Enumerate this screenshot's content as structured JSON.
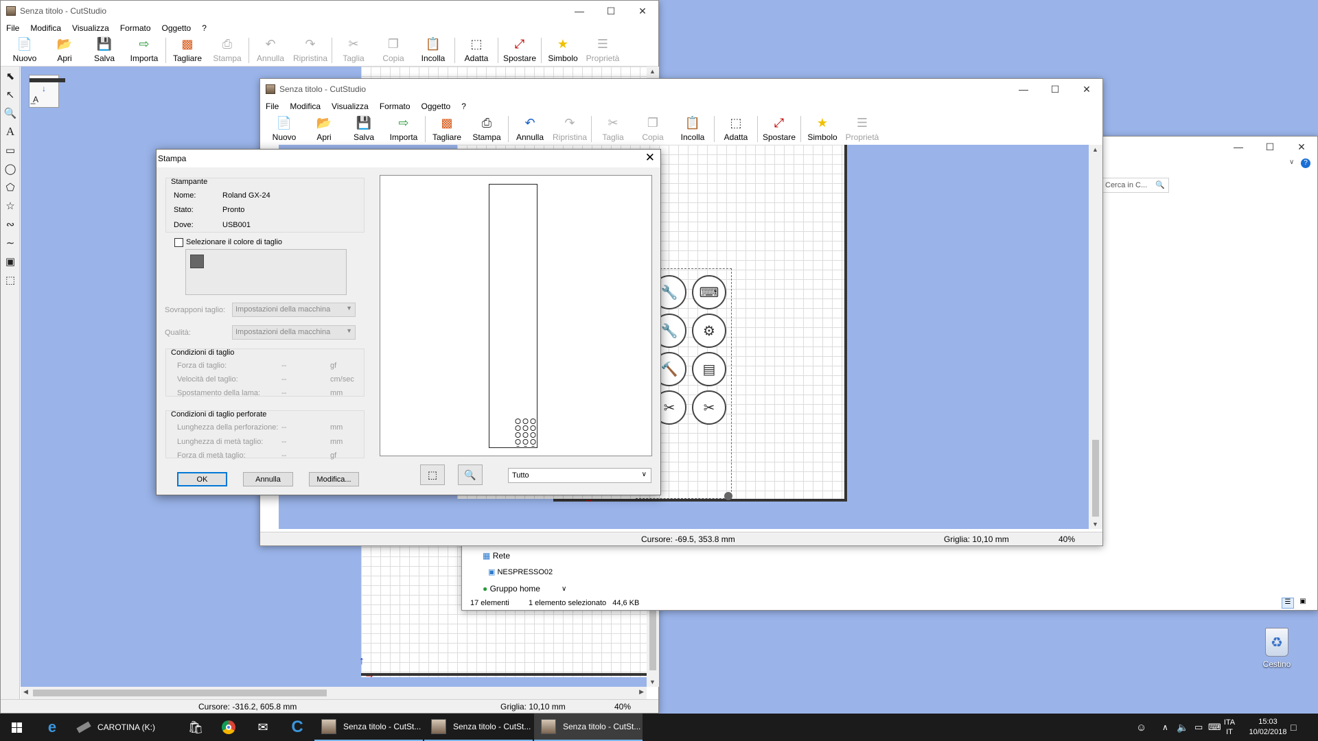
{
  "main_window": {
    "title": "Senza titolo - CutStudio",
    "menu": [
      "File",
      "Modifica",
      "Visualizza",
      "Formato",
      "Oggetto",
      "?"
    ],
    "toolbar": [
      {
        "label": "Nuovo",
        "icon": "new-file-icon",
        "enabled": true
      },
      {
        "label": "Apri",
        "icon": "open-folder-icon",
        "enabled": true
      },
      {
        "label": "Salva",
        "icon": "save-icon",
        "enabled": true
      },
      {
        "label": "Importa",
        "icon": "import-icon",
        "enabled": true
      },
      {
        "label": "Tagliare",
        "icon": "cut-job-icon",
        "enabled": true
      },
      {
        "label": "Stampa",
        "icon": "print-icon",
        "enabled": false
      },
      {
        "label": "Annulla",
        "icon": "undo-icon",
        "enabled": false
      },
      {
        "label": "Ripristina",
        "icon": "redo-icon",
        "enabled": false
      },
      {
        "label": "Taglia",
        "icon": "scissors-icon",
        "enabled": false
      },
      {
        "label": "Copia",
        "icon": "copy-icon",
        "enabled": false
      },
      {
        "label": "Incolla",
        "icon": "paste-icon",
        "enabled": true
      },
      {
        "label": "Adatta",
        "icon": "fit-icon",
        "enabled": true
      },
      {
        "label": "Spostare",
        "icon": "move-icon",
        "enabled": true
      },
      {
        "label": "Simbolo",
        "icon": "star-icon",
        "enabled": true
      },
      {
        "label": "Proprietà",
        "icon": "properties-icon",
        "enabled": false
      }
    ],
    "status": {
      "cursor": "Cursore: -316.2, 605.8 mm",
      "grid": "Griglia: 10,10 mm",
      "zoom": "40%"
    }
  },
  "second_window": {
    "title": "Senza titolo - CutStudio",
    "menu": [
      "File",
      "Modifica",
      "Visualizza",
      "Formato",
      "Oggetto",
      "?"
    ],
    "toolbar": [
      {
        "label": "Nuovo",
        "icon": "new-file-icon",
        "enabled": true
      },
      {
        "label": "Apri",
        "icon": "open-folder-icon",
        "enabled": true
      },
      {
        "label": "Salva",
        "icon": "save-icon",
        "enabled": true
      },
      {
        "label": "Importa",
        "icon": "import-icon",
        "enabled": true
      },
      {
        "label": "Tagliare",
        "icon": "cut-job-icon",
        "enabled": true
      },
      {
        "label": "Stampa",
        "icon": "print-icon",
        "enabled": true
      },
      {
        "label": "Annulla",
        "icon": "undo-icon",
        "enabled": true
      },
      {
        "label": "Ripristina",
        "icon": "redo-icon",
        "enabled": false
      },
      {
        "label": "Taglia",
        "icon": "scissors-icon",
        "enabled": false
      },
      {
        "label": "Copia",
        "icon": "copy-icon",
        "enabled": false
      },
      {
        "label": "Incolla",
        "icon": "paste-icon",
        "enabled": true
      },
      {
        "label": "Adatta",
        "icon": "fit-icon",
        "enabled": true
      },
      {
        "label": "Spostare",
        "icon": "move-icon",
        "enabled": true
      },
      {
        "label": "Simbolo",
        "icon": "star-icon",
        "enabled": true
      },
      {
        "label": "Proprietà",
        "icon": "properties-icon",
        "enabled": false
      }
    ],
    "status": {
      "cursor": "Cursore: -69.5, 353.8 mm",
      "grid": "Griglia: 10,10 mm",
      "zoom": "40%"
    }
  },
  "explorer": {
    "search_placeholder": "Cerca in C...",
    "nav": {
      "network": "Rete",
      "computer": "NESPRESSO02",
      "homegroup": "Gruppo home"
    },
    "status": {
      "count": "17 elementi",
      "selected": "1 elemento selezionato",
      "size": "44,6 KB"
    }
  },
  "print_dialog": {
    "title": "Stampa",
    "printer_group": "Stampante",
    "name_label": "Nome:",
    "name_value": "Roland GX-24",
    "state_label": "Stato:",
    "state_value": "Pronto",
    "where_label": "Dove:",
    "where_value": "USB001",
    "color_checkbox": "Selezionare il colore di taglio",
    "overlap_label": "Sovrapponi taglio:",
    "overlap_value": "Impostazioni della macchina",
    "quality_label": "Qualità:",
    "quality_value": "Impostazioni della macchina",
    "cut_conditions": "Condizioni di taglio",
    "force_label": "Forza di taglio:",
    "force_unit": "gf",
    "speed_label": "Velocità del taglio:",
    "speed_unit": "cm/sec",
    "offset_label": "Spostamento della lama:",
    "offset_unit": "mm",
    "perf_conditions": "Condizioni di taglio perforate",
    "perf_len_label": "Lunghezza della perforazione:",
    "perf_len_unit": "mm",
    "half_len_label": "Lunghezza di metà taglio:",
    "half_len_unit": "mm",
    "half_force_label": "Forza di metà taglio:",
    "half_force_unit": "gf",
    "dash": "--",
    "ok": "OK",
    "cancel": "Annulla",
    "modify": "Modifica...",
    "range_value": "Tutto"
  },
  "desktop": {
    "recycle_bin": "Cestino"
  },
  "taskbar": {
    "drive": "CAROTINA (K:)",
    "apps": [
      "Senza titolo - CutSt...",
      "Senza titolo - CutSt...",
      "Senza titolo - CutSt..."
    ],
    "lang1": "ITA",
    "lang2": "IT",
    "time": "15:03",
    "date": "10/02/2018"
  },
  "colors": {
    "desktop": "#9ab4ea",
    "accent": "#0078d7",
    "taskbar": "#1b1b1b"
  }
}
